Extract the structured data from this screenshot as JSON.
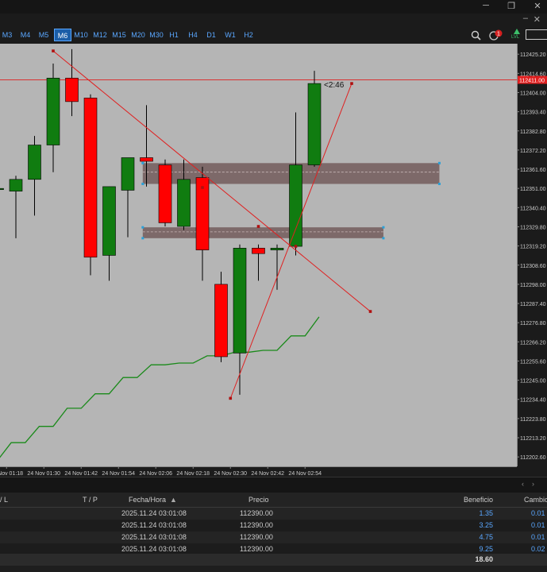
{
  "window": {
    "minimize": "─",
    "restore": "❐",
    "close": "✕",
    "child_min": "–",
    "child_close": "✕"
  },
  "timeframes": [
    {
      "label": "M3"
    },
    {
      "label": "M4"
    },
    {
      "label": "M5"
    },
    {
      "label": "M6",
      "active": true
    },
    {
      "label": "M10"
    },
    {
      "label": "M12"
    },
    {
      "label": "M15"
    },
    {
      "label": "M20"
    },
    {
      "label": "M30"
    },
    {
      "label": "H1"
    },
    {
      "label": "H4"
    },
    {
      "label": "D1"
    },
    {
      "label": "W1"
    },
    {
      "label": "H2"
    }
  ],
  "toolbar_icons": {
    "search": "search-icon",
    "notifications": "bell-icon",
    "notification_count": "1",
    "lvl": "LVL"
  },
  "colors": {
    "chart_bg": "#b5b5b5",
    "bull": "#107c10",
    "bear": "#ff0000",
    "zone": "#735c5c",
    "ma": "#1a8a1a",
    "price_line": "#e02020"
  },
  "chart_data": {
    "type": "candlestick",
    "y_ticks": [
      "112425.20",
      "112414.60",
      "112404.00",
      "112393.40",
      "112382.80",
      "112372.20",
      "112361.60",
      "112351.00",
      "112340.40",
      "112329.80",
      "112319.20",
      "112308.60",
      "112298.00",
      "112287.40",
      "112276.80",
      "112266.20",
      "112255.60",
      "112245.00",
      "112234.40",
      "112223.80",
      "112213.20",
      "112202.60"
    ],
    "x_ticks": [
      "24 Nov 01:18",
      "24 Nov 01:30",
      "24 Nov 01:42",
      "24 Nov 01:54",
      "24 Nov 02:06",
      "24 Nov 02:18",
      "24 Nov 02:30",
      "24 Nov 02:42",
      "24 Nov 02:54"
    ],
    "ylim": [
      112197.4,
      112431.0
    ],
    "current_price": "112411.00",
    "countdown": "<2:46",
    "candles": [
      {
        "o": 112350.5,
        "h": 112351.5,
        "l": 112349.0,
        "c": 112351.0
      },
      {
        "o": 112349.5,
        "h": 112358.0,
        "l": 112323.5,
        "c": 112356.0
      },
      {
        "o": 112356.0,
        "h": 112380.0,
        "l": 112336.0,
        "c": 112375.0
      },
      {
        "o": 112375.0,
        "h": 112420.0,
        "l": 112360.0,
        "c": 112412.0
      },
      {
        "o": 112412.0,
        "h": 112428.0,
        "l": 112391.0,
        "c": 112399.0
      },
      {
        "o": 112401.0,
        "h": 112403.0,
        "l": 112303.0,
        "c": 112313.0
      },
      {
        "o": 112314.0,
        "h": 112352.0,
        "l": 112300.0,
        "c": 112352.0
      },
      {
        "o": 112350.0,
        "h": 112368.0,
        "l": 112324.0,
        "c": 112368.0
      },
      {
        "o": 112368.0,
        "h": 112397.0,
        "l": 112352.0,
        "c": 112366.0
      },
      {
        "o": 112364.0,
        "h": 112367.0,
        "l": 112330.0,
        "c": 112332.0
      },
      {
        "o": 112330.0,
        "h": 112367.0,
        "l": 112328.0,
        "c": 112356.0
      },
      {
        "o": 112357.0,
        "h": 112363.0,
        "l": 112300.0,
        "c": 112317.0
      },
      {
        "o": 112298.0,
        "h": 112305.0,
        "l": 112255.0,
        "c": 112258.0
      },
      {
        "o": 112260.0,
        "h": 112320.0,
        "l": 112237.0,
        "c": 112318.0
      },
      {
        "o": 112318.0,
        "h": 112320.0,
        "l": 112300.0,
        "c": 112315.0
      },
      {
        "o": 112317.0,
        "h": 112320.0,
        "l": 112295.0,
        "c": 112318.0
      },
      {
        "o": 112319.0,
        "h": 112393.0,
        "l": 112314.0,
        "c": 112364.0
      },
      {
        "o": 112364.0,
        "h": 112416.0,
        "l": 112363.0,
        "c": 112409.0
      }
    ],
    "zones": [
      {
        "top": 112365.0,
        "bottom": 112353.5,
        "mid": 112360.0
      },
      {
        "top": 112329.5,
        "bottom": 112323.5,
        "mid": 112327.0
      }
    ],
    "ma": [
      112200.5,
      112210.5,
      112210.5,
      112219.5,
      112219.5,
      112229.5,
      112229.5,
      112237.5,
      112237.5,
      112246.5,
      112246.5,
      112253.5,
      112253.5,
      112254.5,
      112254.5,
      112258.5,
      112258.5,
      112260.5,
      112260.5,
      112261.5,
      112261.5,
      112269.5,
      112269.5,
      112280.0
    ],
    "lines": [
      {
        "from": [
          3,
          112427.0
        ],
        "to": [
          20,
          112283.0
        ],
        "mids": [
          [
            11,
            112351.5
          ],
          [
            14,
            112330.0
          ],
          [
            16,
            112319.0
          ]
        ]
      },
      {
        "from": [
          12.5,
          112235.0
        ],
        "to": [
          19,
          112409.0
        ],
        "mids": []
      }
    ]
  },
  "terminal": {
    "headers": {
      "sl": "/ L",
      "tp": "T / P",
      "time": "Fecha/Hora",
      "sort": "▲",
      "price": "Precio",
      "profit": "Beneficio",
      "change": "Cambio"
    },
    "rows": [
      {
        "time": "2025.11.24 03:01:08",
        "price": "112390.00",
        "profit": "1.35",
        "change": "0.01 %"
      },
      {
        "time": "2025.11.24 03:01:08",
        "price": "112390.00",
        "profit": "3.25",
        "change": "0.01 %"
      },
      {
        "time": "2025.11.24 03:01:08",
        "price": "112390.00",
        "profit": "4.75",
        "change": "0.01 %"
      },
      {
        "time": "2025.11.24 03:01:08",
        "price": "112390.00",
        "profit": "9.25",
        "change": "0.02 %"
      }
    ],
    "total": "18.60"
  }
}
